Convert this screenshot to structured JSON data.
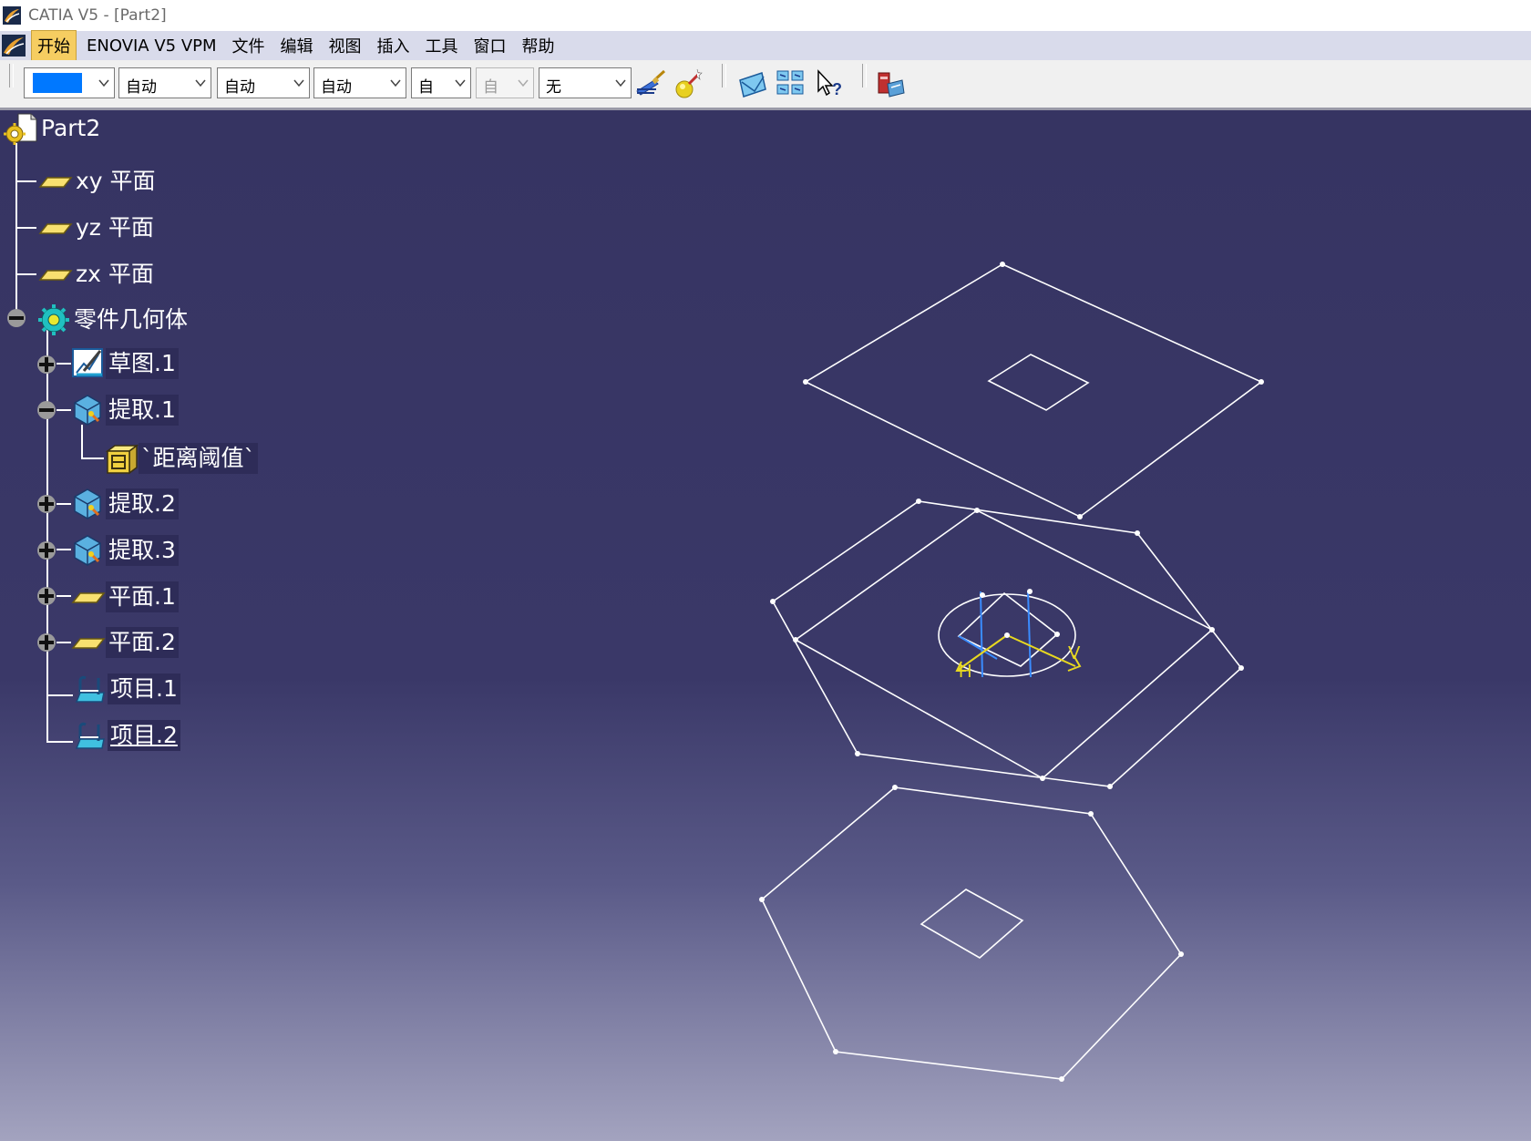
{
  "window": {
    "title": "CATIA V5 - [Part2]"
  },
  "menubar": {
    "items": [
      {
        "label": "开始",
        "active": true
      },
      {
        "label": "ENOVIA V5 VPM",
        "active": false
      },
      {
        "label": "文件",
        "active": false
      },
      {
        "label": "编辑",
        "active": false
      },
      {
        "label": "视图",
        "active": false
      },
      {
        "label": "插入",
        "active": false
      },
      {
        "label": "工具",
        "active": false
      },
      {
        "label": "窗口",
        "active": false
      },
      {
        "label": "帮助",
        "active": false
      }
    ]
  },
  "toolbar": {
    "color_value": "#0078ff",
    "line_weight": "自动",
    "line_type": "自动",
    "point_type": "自动",
    "layer": "自动",
    "disabled_field": "自动",
    "render_style": "无",
    "icons": [
      "painter-brush-icon",
      "magic-wand-icon",
      "sketch-plane-icon",
      "multi-view-icon",
      "whats-this-icon",
      "catalog-icon"
    ]
  },
  "tree": {
    "root": "Part2",
    "planes": [
      "xy 平面",
      "yz 平面",
      "zx 平面"
    ],
    "body": "零件几何体",
    "children": [
      {
        "label": "草图.1",
        "icon": "sketch-icon",
        "expander": "plus"
      },
      {
        "label": "提取.1",
        "icon": "extract-icon",
        "expander": "minus"
      },
      {
        "label": "`距离阈值`",
        "icon": "parameter-icon",
        "expander": "none"
      },
      {
        "label": "提取.2",
        "icon": "extract-icon",
        "expander": "plus"
      },
      {
        "label": "提取.3",
        "icon": "extract-icon",
        "expander": "plus"
      },
      {
        "label": "平面.1",
        "icon": "plane-icon",
        "expander": "plus"
      },
      {
        "label": "平面.2",
        "icon": "plane-icon",
        "expander": "plus"
      },
      {
        "label": "项目.1",
        "icon": "projection-icon",
        "expander": "none"
      },
      {
        "label": "项目.2",
        "icon": "projection-icon",
        "expander": "none"
      }
    ]
  },
  "sketch_axes": {
    "h_label": "H",
    "v_label": "V"
  },
  "colors": {
    "viewport_top": "#363462",
    "viewport_bottom": "#a3a3bf",
    "geometry": "#ffffff",
    "axis_h": "#e8d820",
    "axis_blue": "#3a8cff"
  }
}
